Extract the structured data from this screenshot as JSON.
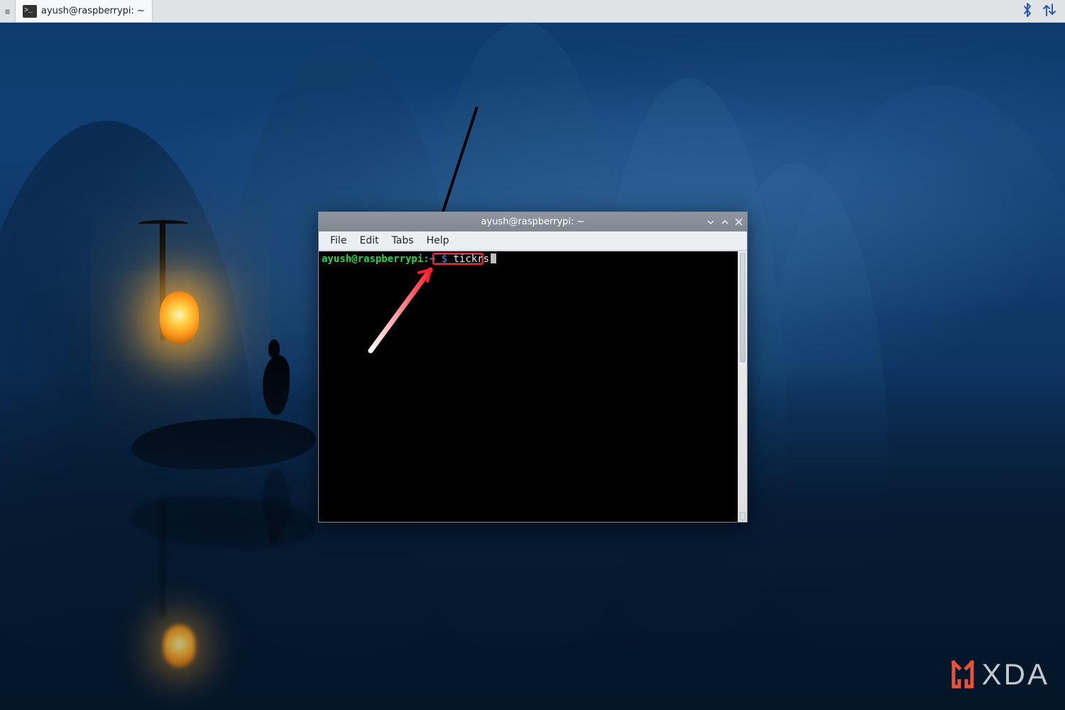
{
  "taskbar": {
    "window_title": "ayush@raspberrypi: ~",
    "terminal_icon_glyph": ">_"
  },
  "tray": {
    "bluetooth_icon": "bluetooth-icon",
    "network_icon": "network-updown-icon"
  },
  "window": {
    "title": "ayush@raspberrypi: ~"
  },
  "menubar": {
    "file": "File",
    "edit": "Edit",
    "tabs": "Tabs",
    "help": "Help"
  },
  "terminal": {
    "prompt_user": "ayush@raspberrypi",
    "prompt_sep": ":",
    "prompt_path": "~",
    "prompt_dollar": " $",
    "command": "tickrs"
  },
  "watermark": {
    "text": "XDA"
  },
  "colors": {
    "arrow": "#ff1e2d",
    "prompt_user": "#26d44a",
    "prompt_path": "#4d8ef7"
  }
}
